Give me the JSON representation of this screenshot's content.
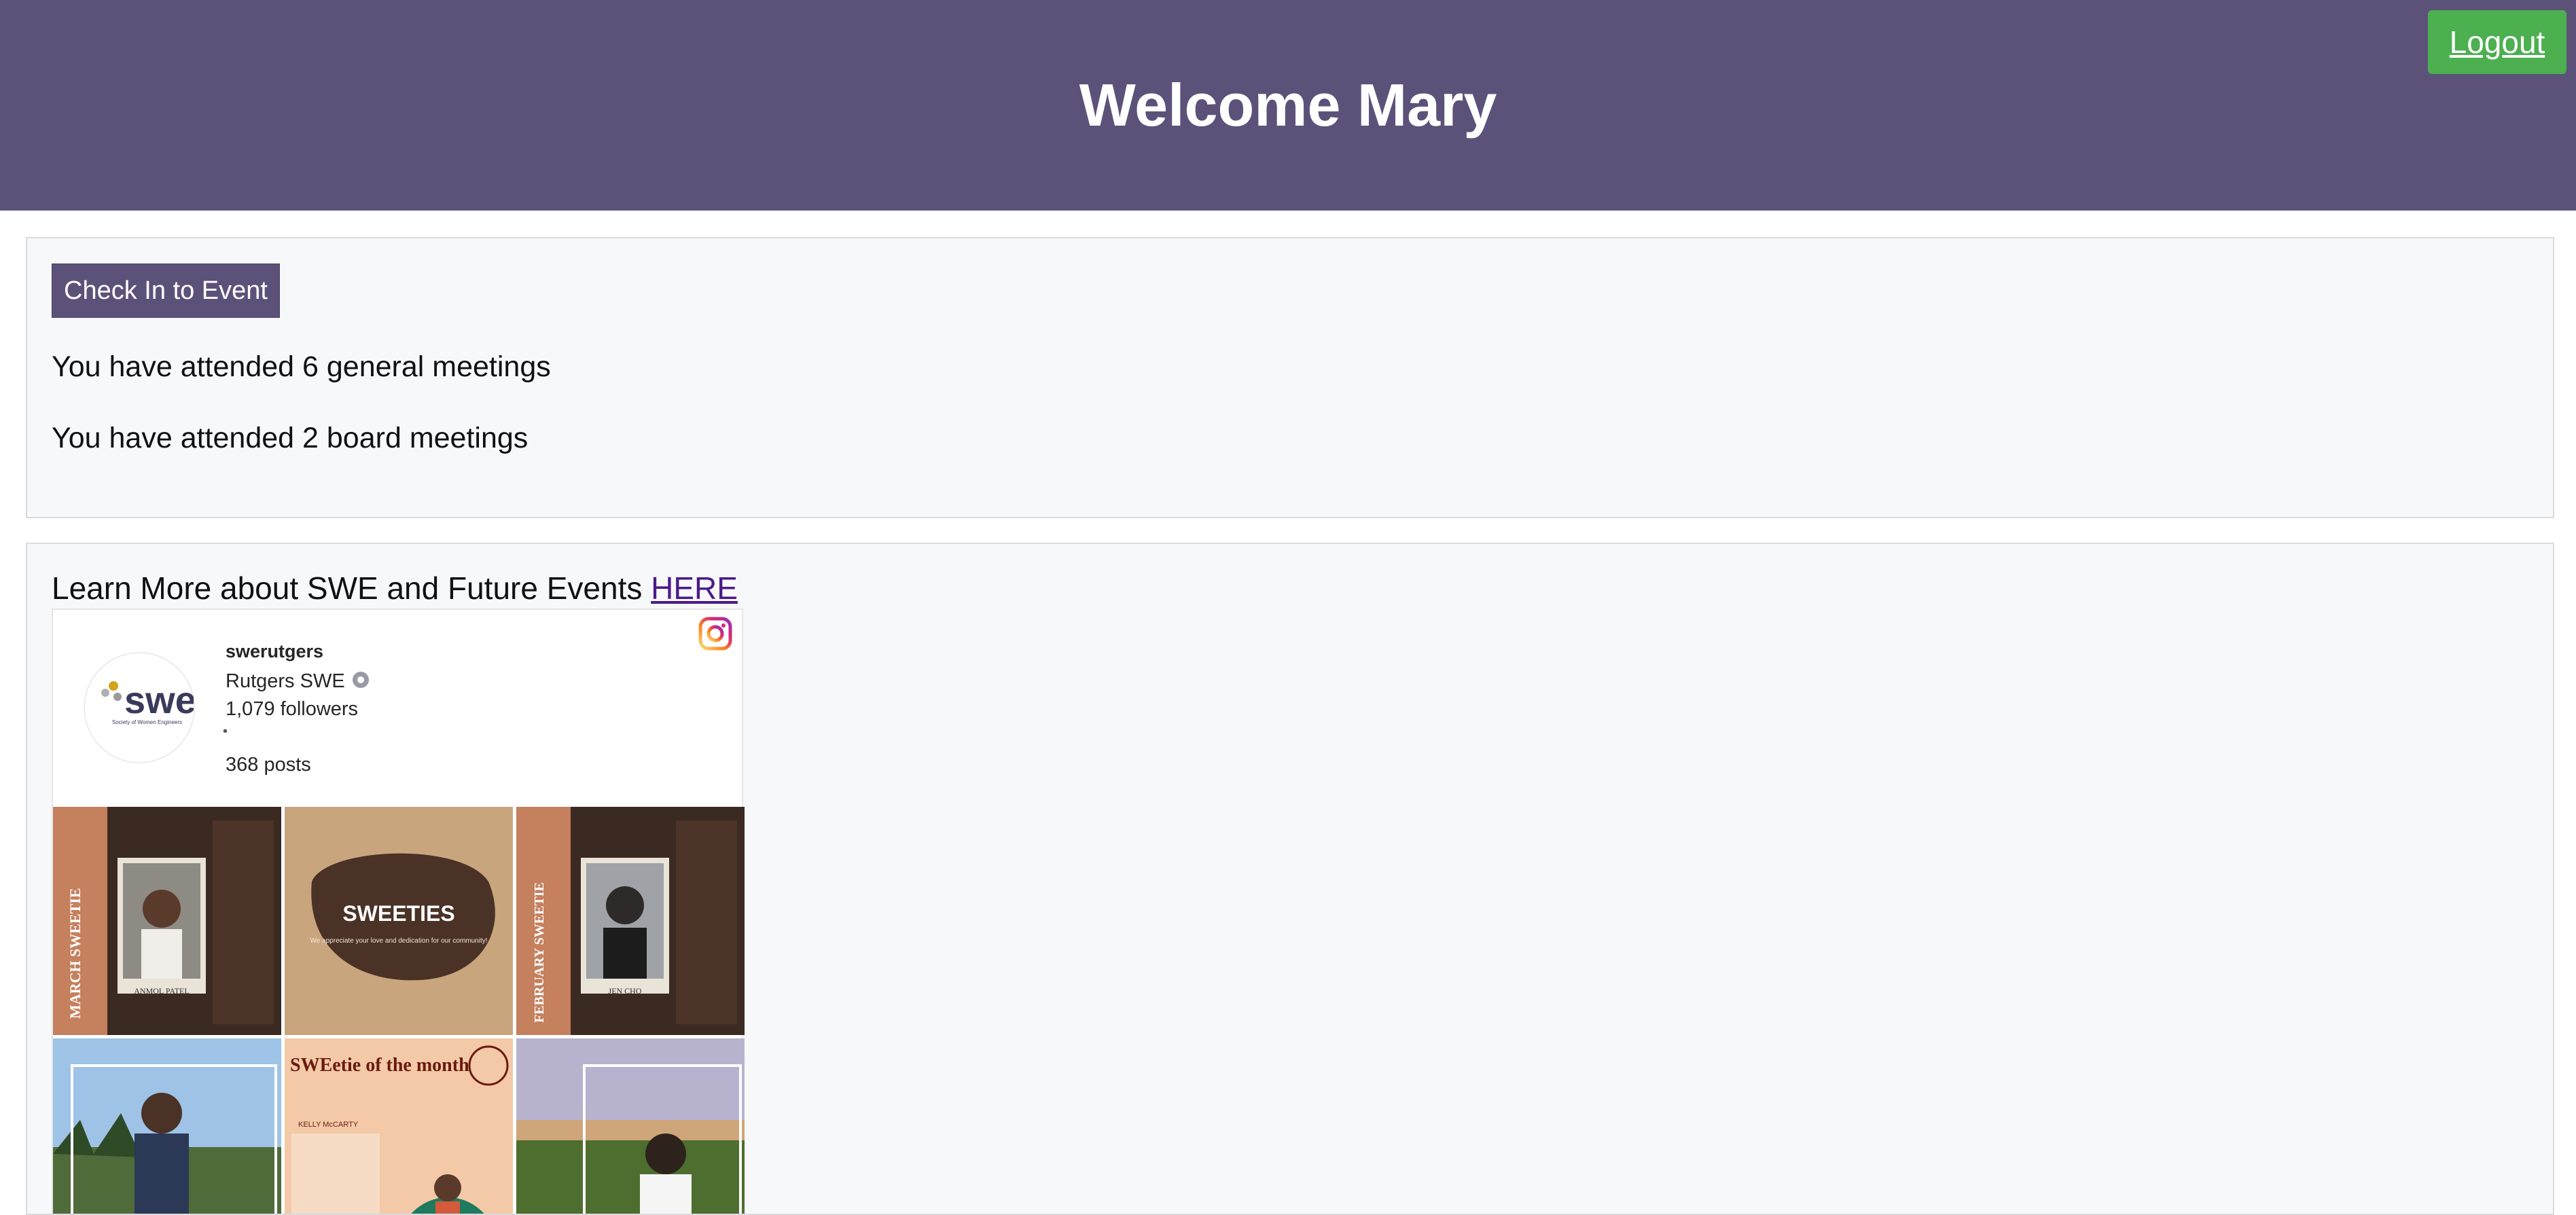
{
  "header": {
    "title": "Welcome Mary",
    "logout_label": "Logout"
  },
  "attendance": {
    "checkin_label": "Check In to Event",
    "general_text": "You have attended 6 general meetings",
    "board_text": "You have attended 2 board meetings"
  },
  "learn": {
    "text": "Learn More about SWE and Future Events",
    "link_label": "HERE"
  },
  "instagram": {
    "handle": "swerutgers",
    "name": "Rutgers SWE",
    "followers": "1,079 followers",
    "separator": "•",
    "posts": "368 posts",
    "avatar_text": "swe",
    "avatar_subtext": "Society of Women Engineers",
    "icons": [
      "instagram-icon",
      "verified-icon"
    ],
    "post_images": [
      {
        "title": "MARCH SWEETIE",
        "name": "ANMOL PATEL"
      },
      {
        "title": "SWEETIES",
        "subtitle": "We appreciate your love and dedication for our community!"
      },
      {
        "title": "FEBRUARY SWEETIE",
        "name": "JEN CHO"
      },
      {
        "title": ""
      },
      {
        "title": "SWEetie of the month",
        "name": "KELLY McCARTY"
      },
      {
        "title": ""
      }
    ]
  },
  "colors": {
    "header_bg": "#5c5279",
    "logout_bg": "#4caf50",
    "button_bg": "#5c5279",
    "panel_bg": "#f7f8fa",
    "link": "#4b1a8a"
  }
}
